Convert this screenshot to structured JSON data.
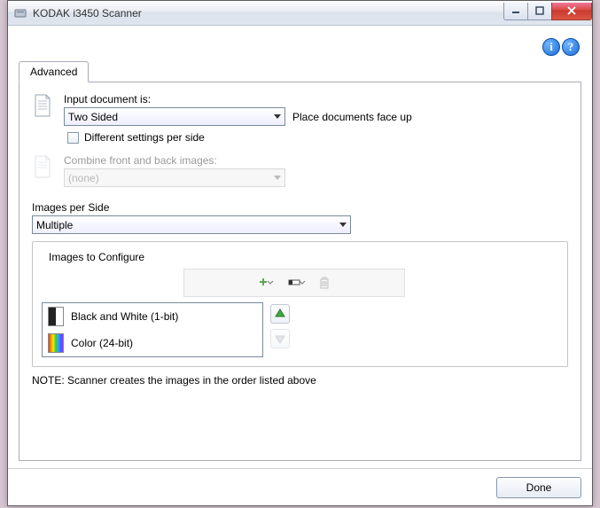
{
  "window": {
    "title": "KODAK i3450 Scanner"
  },
  "header": {
    "info_icon": "i",
    "help_icon": "?"
  },
  "tabs": [
    {
      "label": "Advanced"
    }
  ],
  "input_doc": {
    "label": "Input document is:",
    "value": "Two Sided",
    "hint": "Place documents face up"
  },
  "diff_settings": {
    "label": "Different settings per side",
    "checked": false
  },
  "combine": {
    "label": "Combine front and back images:",
    "value": "(none)",
    "enabled": false
  },
  "images_per_side": {
    "label": "Images per Side",
    "value": "Multiple"
  },
  "configure": {
    "legend": "Images to Configure",
    "toolbar": {
      "add_icon": "plus-icon",
      "mode_icon": "mode-icon",
      "delete_icon": "trash-icon"
    },
    "items": [
      {
        "label": "Black and White (1-bit)",
        "thumb": "bw"
      },
      {
        "label": "Color (24-bit)",
        "thumb": "color"
      }
    ],
    "note": "NOTE: Scanner creates the images in the order listed above"
  },
  "footer": {
    "done": "Done"
  }
}
